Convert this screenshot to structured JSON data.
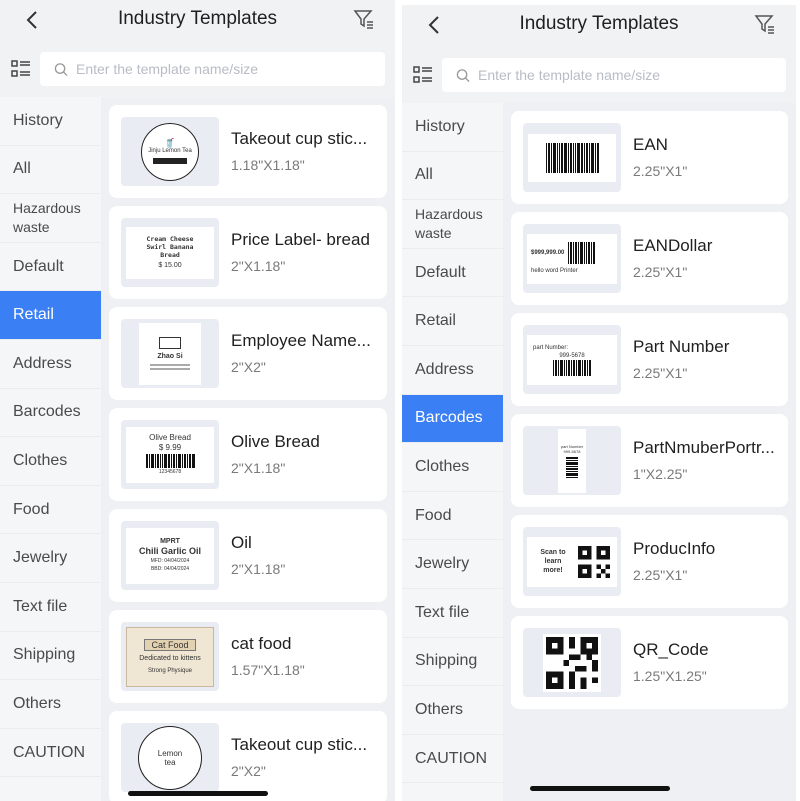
{
  "left": {
    "header": {
      "title": "Industry Templates"
    },
    "search": {
      "placeholder": "Enter the template name/size"
    },
    "sidebar": [
      "History",
      "All",
      "Hazardous waste",
      "Default",
      "Retail",
      "Address",
      "Barcodes",
      "Clothes",
      "Food",
      "Jewelry",
      "Text file",
      "Shipping",
      "Others",
      "CAUTION"
    ],
    "active_category": "Retail",
    "cards": [
      {
        "name": "Takeout cup stic...",
        "size": "1.18\"X1.18\"",
        "thumb": "round-cup-label",
        "thumb_text": "Jinju Lemon Tea"
      },
      {
        "name": "Price Label- bread",
        "size": "2\"X1.18\"",
        "thumb": "bread-label",
        "thumb_text": "Cream Cheese Swirl Banana Bread",
        "thumb_price": "$ 15.00"
      },
      {
        "name": "Employee Name...",
        "size": "2\"X2\"",
        "thumb": "employee-label",
        "thumb_text": "Zhao Si"
      },
      {
        "name": "Olive Bread",
        "size": "2\"X1.18\"",
        "thumb": "olive-label",
        "thumb_text": "Olive Bread",
        "thumb_price": "$ 9.99",
        "thumb_code": "12345678"
      },
      {
        "name": "Oil",
        "size": "2\"X1.18\"",
        "thumb": "oil-label",
        "thumb_brand": "MPRT",
        "thumb_text": "Chili Garlic Oil",
        "thumb_mfd": "MFD: 04/04/2024",
        "thumb_bbd": "BBD: 04/04/2024"
      },
      {
        "name": "cat food",
        "size": "1.57\"X1.18\"",
        "thumb": "cat-label",
        "thumb_text": "Cat Food",
        "thumb_sub": "Dedicated to kittens",
        "thumb_foot": "Strong Physique"
      },
      {
        "name": "Takeout cup stic...",
        "size": "2\"X2\"",
        "thumb": "round-lemon-label",
        "thumb_text": "Lemon tea"
      }
    ]
  },
  "right": {
    "header": {
      "title": "Industry Templates"
    },
    "search": {
      "placeholder": "Enter the template name/size"
    },
    "sidebar": [
      "History",
      "All",
      "Hazardous waste",
      "Default",
      "Retail",
      "Address",
      "Barcodes",
      "Clothes",
      "Food",
      "Jewelry",
      "Text file",
      "Shipping",
      "Others",
      "CAUTION"
    ],
    "active_category": "Barcodes",
    "cards": [
      {
        "name": "EAN",
        "size": "2.25\"X1\"",
        "thumb": "ean-barcode"
      },
      {
        "name": "EANDollar",
        "size": "2.25\"X1\"",
        "thumb": "ean-dollar",
        "thumb_price": "$999,999.00",
        "thumb_text": "hello word Printer"
      },
      {
        "name": "Part Number",
        "size": "2.25\"X1\"",
        "thumb": "part-number",
        "thumb_text": "part Number:",
        "thumb_code": "999-5678"
      },
      {
        "name": "PartNmuberPortr...",
        "size": "1\"X2.25\"",
        "thumb": "part-portrait",
        "thumb_text": "part Number",
        "thumb_code": "999-5678"
      },
      {
        "name": "ProducInfo",
        "size": "2.25\"X1\"",
        "thumb": "product-qr",
        "thumb_text": "Scan to learn more!"
      },
      {
        "name": "QR_Code",
        "size": "1.25\"X1.25\"",
        "thumb": "qr-code"
      }
    ]
  },
  "icons": [
    "back-icon",
    "filter-icon",
    "list-view-icon",
    "search-icon"
  ],
  "colors": {
    "accent": "#3a7ff3",
    "background": "#f1f2f4",
    "card": "#ffffff"
  }
}
